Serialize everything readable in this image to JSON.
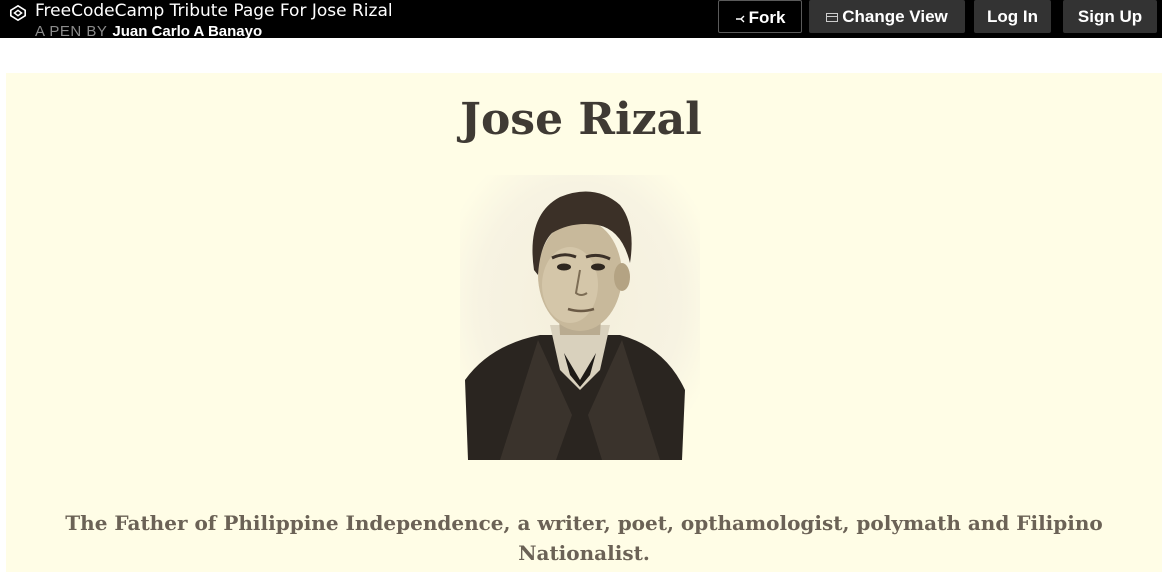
{
  "header": {
    "pen_title": "FreeCodeCamp Tribute Page For Jose Rizal",
    "by_label": "A PEN BY",
    "author": "Juan Carlo A Banayo",
    "buttons": {
      "fork": "Fork",
      "change_view": "Change View",
      "login": "Log In",
      "signup": "Sign Up"
    }
  },
  "tribute": {
    "title": "Jose Rizal",
    "tagline": "The Father of Philippine Independence, a writer, poet, opthamologist, polymath and Filipino Nationalist."
  },
  "icons": {
    "logo": "codepen-logo-icon",
    "fork": "fork-icon",
    "change_view": "layout-icon"
  },
  "colors": {
    "topbar": "#000000",
    "button": "#333333",
    "preview_background": "#fffde6",
    "title": "#3f3a34",
    "tagline": "#6b6256"
  }
}
